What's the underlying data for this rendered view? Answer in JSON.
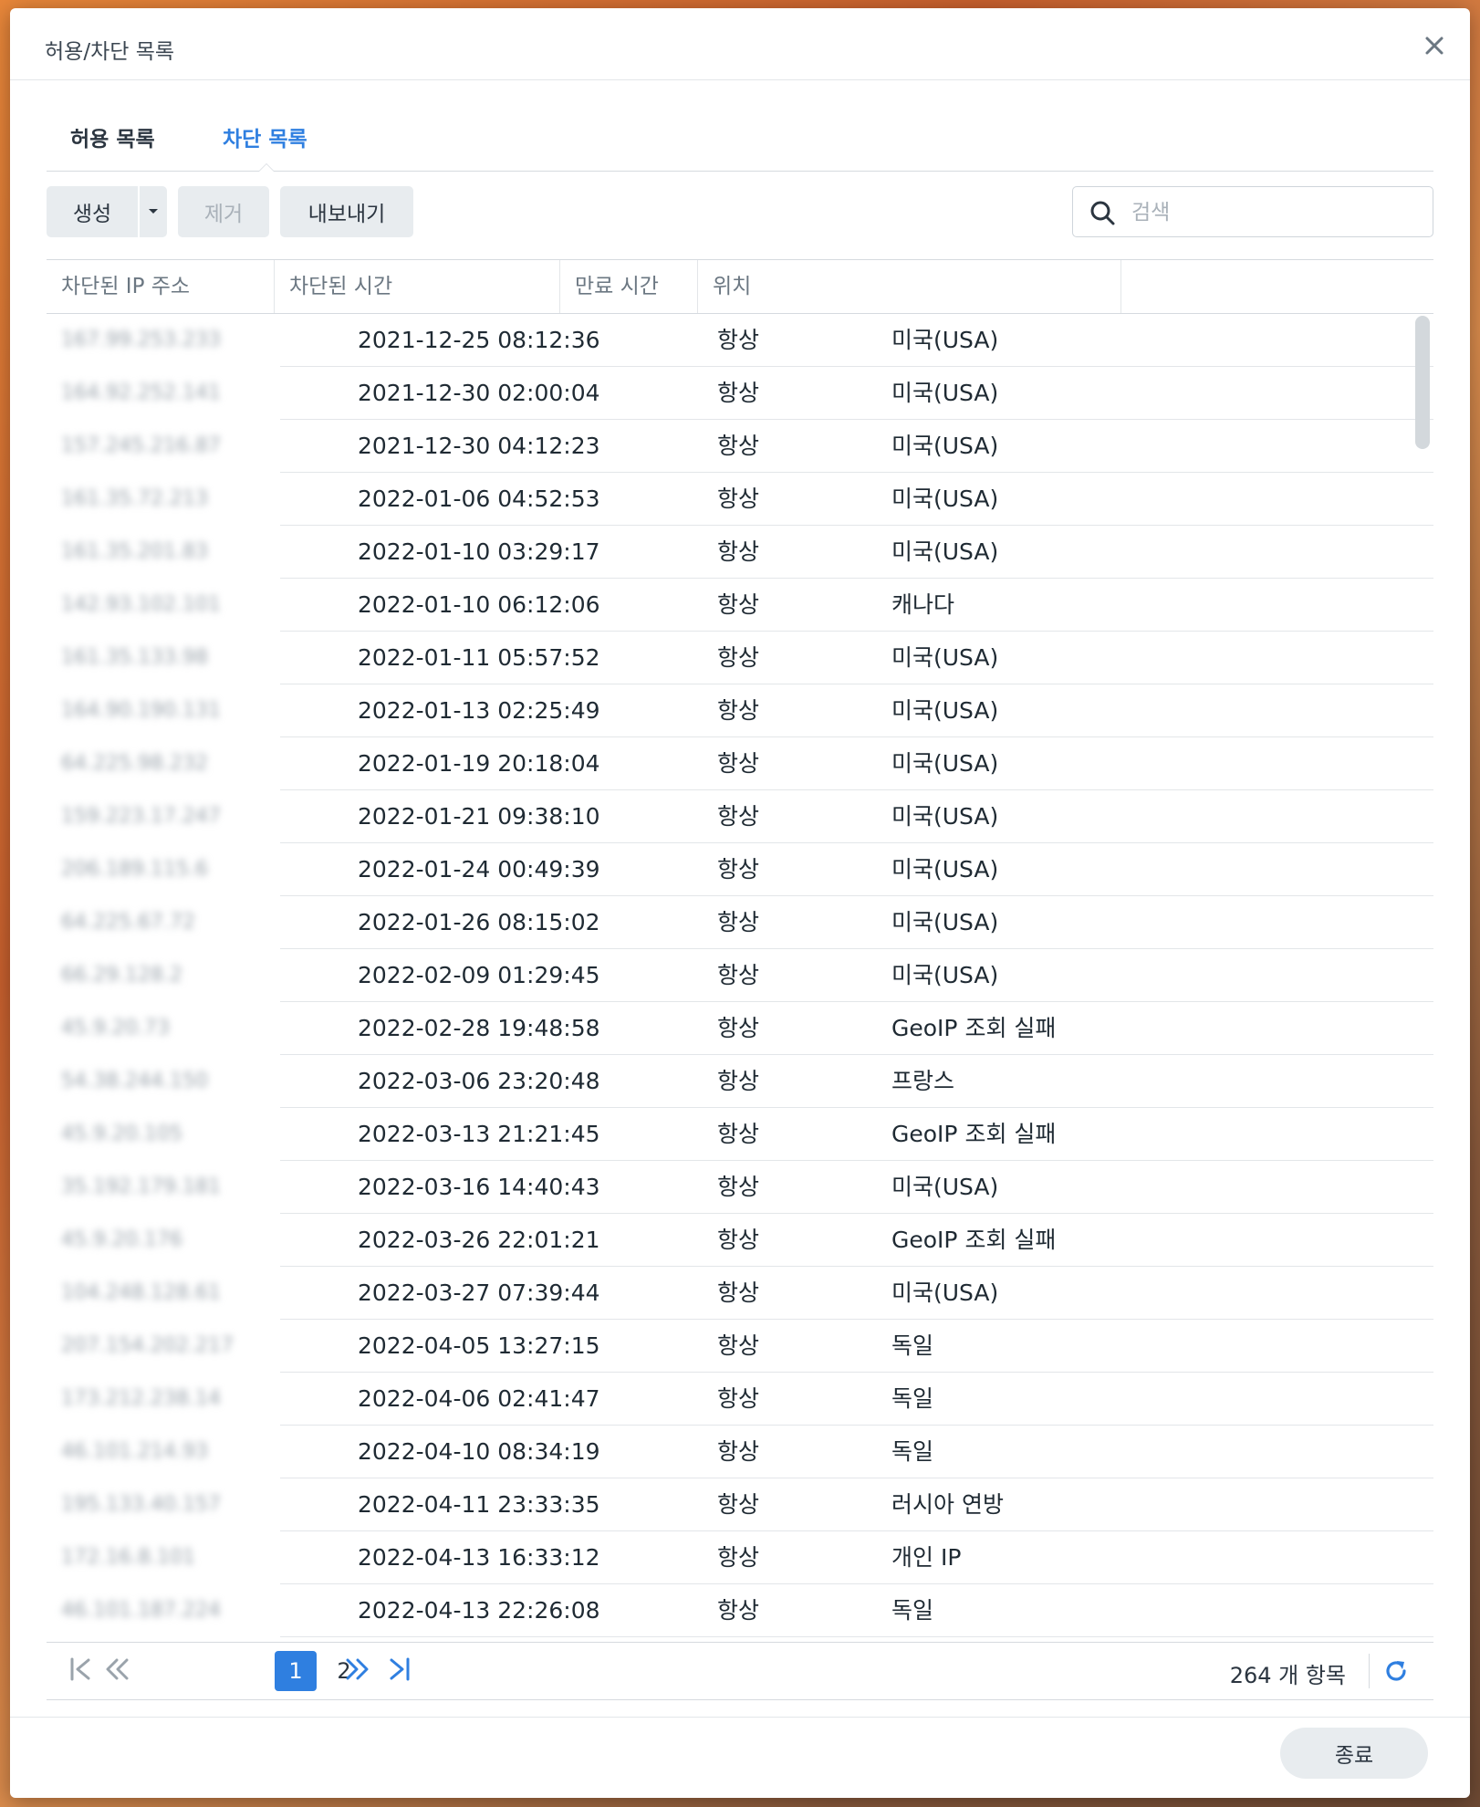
{
  "dialog": {
    "title": "허용/차단 목록"
  },
  "tabs": [
    {
      "label": "허용 목록"
    },
    {
      "label": "차단 목록"
    }
  ],
  "toolbar": {
    "create_label": "생성",
    "remove_label": "제거",
    "export_label": "내보내기"
  },
  "search": {
    "placeholder": "검색",
    "value": ""
  },
  "table": {
    "headers": [
      "차단된 IP 주소",
      "차단된 시간",
      "만료 시간",
      "위치"
    ],
    "rows": [
      {
        "ip": "167.99.253.233",
        "time": "2021-12-25 08:12:36",
        "expire": "항상",
        "location": "미국(USA)"
      },
      {
        "ip": "164.92.252.141",
        "time": "2021-12-30 02:00:04",
        "expire": "항상",
        "location": "미국(USA)"
      },
      {
        "ip": "157.245.216.87",
        "time": "2021-12-30 04:12:23",
        "expire": "항상",
        "location": "미국(USA)"
      },
      {
        "ip": "161.35.72.213",
        "time": "2022-01-06 04:52:53",
        "expire": "항상",
        "location": "미국(USA)"
      },
      {
        "ip": "161.35.201.83",
        "time": "2022-01-10 03:29:17",
        "expire": "항상",
        "location": "미국(USA)"
      },
      {
        "ip": "142.93.102.101",
        "time": "2022-01-10 06:12:06",
        "expire": "항상",
        "location": "캐나다"
      },
      {
        "ip": "161.35.133.98",
        "time": "2022-01-11 05:57:52",
        "expire": "항상",
        "location": "미국(USA)"
      },
      {
        "ip": "164.90.190.131",
        "time": "2022-01-13 02:25:49",
        "expire": "항상",
        "location": "미국(USA)"
      },
      {
        "ip": "64.225.98.232",
        "time": "2022-01-19 20:18:04",
        "expire": "항상",
        "location": "미국(USA)"
      },
      {
        "ip": "159.223.17.247",
        "time": "2022-01-21 09:38:10",
        "expire": "항상",
        "location": "미국(USA)"
      },
      {
        "ip": "206.189.115.6",
        "time": "2022-01-24 00:49:39",
        "expire": "항상",
        "location": "미국(USA)"
      },
      {
        "ip": "64.225.67.72",
        "time": "2022-01-26 08:15:02",
        "expire": "항상",
        "location": "미국(USA)"
      },
      {
        "ip": "66.29.128.2",
        "time": "2022-02-09 01:29:45",
        "expire": "항상",
        "location": "미국(USA)"
      },
      {
        "ip": "45.9.20.73",
        "time": "2022-02-28 19:48:58",
        "expire": "항상",
        "location": "GeoIP 조회 실패"
      },
      {
        "ip": "54.38.244.150",
        "time": "2022-03-06 23:20:48",
        "expire": "항상",
        "location": "프랑스"
      },
      {
        "ip": "45.9.20.105",
        "time": "2022-03-13 21:21:45",
        "expire": "항상",
        "location": "GeoIP 조회 실패"
      },
      {
        "ip": "35.192.179.181",
        "time": "2022-03-16 14:40:43",
        "expire": "항상",
        "location": "미국(USA)"
      },
      {
        "ip": "45.9.20.176",
        "time": "2022-03-26 22:01:21",
        "expire": "항상",
        "location": "GeoIP 조회 실패"
      },
      {
        "ip": "104.248.128.61",
        "time": "2022-03-27 07:39:44",
        "expire": "항상",
        "location": "미국(USA)"
      },
      {
        "ip": "207.154.202.217",
        "time": "2022-04-05 13:27:15",
        "expire": "항상",
        "location": "독일"
      },
      {
        "ip": "173.212.238.14",
        "time": "2022-04-06 02:41:47",
        "expire": "항상",
        "location": "독일"
      },
      {
        "ip": "46.101.214.93",
        "time": "2022-04-10 08:34:19",
        "expire": "항상",
        "location": "독일"
      },
      {
        "ip": "195.133.40.157",
        "time": "2022-04-11 23:33:35",
        "expire": "항상",
        "location": "러시아 연방"
      },
      {
        "ip": "172.16.8.101",
        "time": "2022-04-13 16:33:12",
        "expire": "항상",
        "location": "개인 IP"
      },
      {
        "ip": "46.101.187.224",
        "time": "2022-04-13 22:26:08",
        "expire": "항상",
        "location": "독일"
      }
    ]
  },
  "pager": {
    "pages": [
      "1",
      "2"
    ],
    "current_page": "1",
    "count_label": "264 개 항목"
  },
  "footer": {
    "close_label": "종료"
  },
  "colors": {
    "accent": "#2f7fe0",
    "button_bg": "#e8ecef"
  },
  "icons": [
    "close-icon",
    "dropdown-arrow-icon",
    "search-icon",
    "first-page-icon",
    "prev-page-icon",
    "next-page-icon",
    "last-page-icon",
    "refresh-icon"
  ]
}
